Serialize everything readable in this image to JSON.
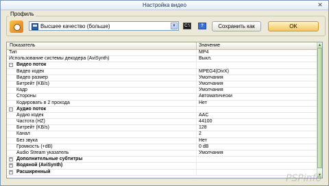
{
  "window": {
    "title": "Настройка видео",
    "close_label": "✕"
  },
  "profile": {
    "group_label": "Профиль",
    "selected": "Высшее качество (больше)",
    "cmd_label": "C:\\",
    "help_label": "?",
    "save_as_label": "Сохранить как",
    "ok_label": "OK"
  },
  "table": {
    "headers": [
      "Показатель",
      "Значение"
    ],
    "rows": [
      {
        "name": "Тип",
        "value": "MP4"
      },
      {
        "name": "Использование системы декодера (AviSynth)",
        "value": "Выкл."
      },
      {
        "name": "Видео поток",
        "value": "",
        "toggle": "−"
      },
      {
        "name": "Видео кодек",
        "value": "MPEG4(DivX)"
      },
      {
        "name": "Видео размер",
        "value": "Умолчания"
      },
      {
        "name": "Битрейт (KB/s)",
        "value": "Умолчания"
      },
      {
        "name": "Кадр",
        "value": "Умолчания"
      },
      {
        "name": "Стороны",
        "value": "Автоматически"
      },
      {
        "name": "Кодировать в 2 прохода",
        "value": "Нет"
      },
      {
        "name": "Аудио поток",
        "value": "",
        "toggle": "−"
      },
      {
        "name": "Аудио кодек",
        "value": "AAC"
      },
      {
        "name": "Частота (HZ)",
        "value": "44100"
      },
      {
        "name": "Битрейт (KB/s)",
        "value": "128"
      },
      {
        "name": "Канал",
        "value": "2"
      },
      {
        "name": "Без звука",
        "value": "Нет"
      },
      {
        "name": "Громкость (+dB)",
        "value": "0 dB"
      },
      {
        "name": "Audio Stream указатель",
        "value": "Умолчания"
      },
      {
        "name": "Дополнительные субтитры",
        "value": "",
        "toggle": "+"
      },
      {
        "name": "Водяной (AviSynth)",
        "value": "",
        "toggle": "+"
      },
      {
        "name": "Расширенный",
        "value": "",
        "toggle": "+"
      }
    ]
  },
  "scroll": {
    "up": "▲",
    "down": "▼"
  },
  "watermark": "PSPinfo"
}
